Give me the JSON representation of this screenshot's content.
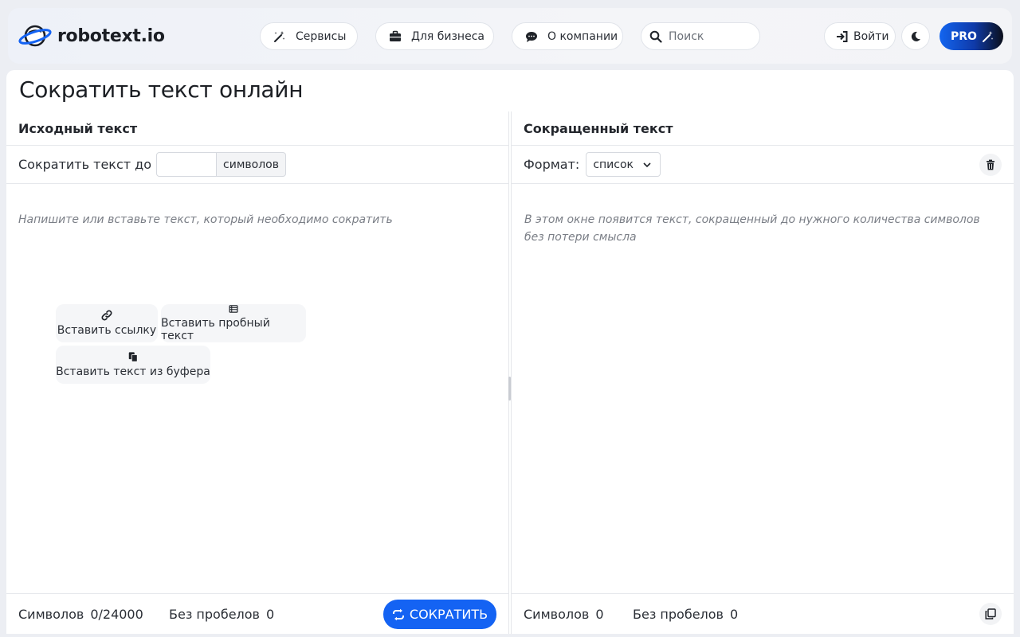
{
  "header": {
    "logo_text": "robotext.io",
    "nav": {
      "services": "Сервисы",
      "business": "Для бизнеса",
      "about": "О компании"
    },
    "search_placeholder": "Поиск",
    "login": "Войти",
    "pro": "PRO"
  },
  "page": {
    "title": "Сократить текст онлайн"
  },
  "left_panel": {
    "heading": "Исходный текст",
    "limit_label": "Сократить текст до",
    "limit_value": "",
    "limit_unit": "символов",
    "placeholder": "Напишите или вставьте текст, который необходимо сократить",
    "actions": {
      "insert_link": "Вставить ссылку",
      "insert_sample": "Вставить пробный текст",
      "insert_buffer": "Вставить текст из буфера"
    },
    "footer": {
      "chars_label": "Символов",
      "chars_value": "0/24000",
      "nospace_label": "Без пробелов",
      "nospace_value": "0",
      "shorten_button": "СОКРАТИТЬ"
    }
  },
  "right_panel": {
    "heading": "Сокращенный текст",
    "format_label": "Формат:",
    "format_value": "список",
    "placeholder": "В этом окне появится текст, сокращенный до нужного количества символов без потери смысла",
    "footer": {
      "chars_label": "Символов",
      "chars_value": "0",
      "nospace_label": "Без пробелов",
      "nospace_value": "0"
    }
  },
  "colors": {
    "accent": "#1463f3",
    "background": "#eceef3",
    "text": "#1f2329"
  }
}
